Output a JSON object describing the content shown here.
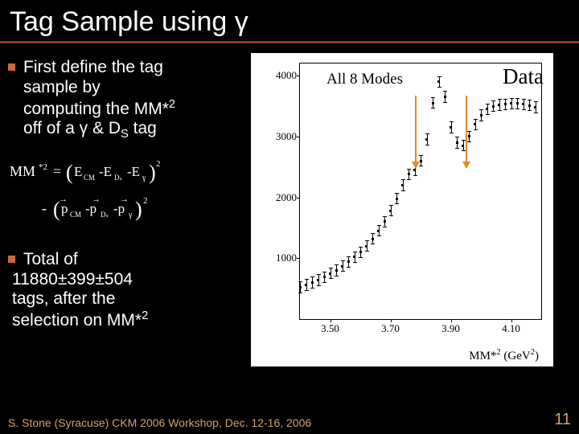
{
  "title": "Tag Sample using γ",
  "bullets": [
    "First  define the tag sample by computing the MM*² off of a γ & Dₛ tag",
    "Total of 11880±399±504 tags, after the selection on MM*²"
  ],
  "bullet1_lines": {
    "l1": "First  define the tag",
    "l2": "sample by",
    "l3_a": "computing the MM*",
    "l3_sup": "2",
    "l4_a": "off of a γ & D",
    "l4_sub": "S",
    "l4_b": " tag"
  },
  "bullet2_lines": {
    "l1": "Total of",
    "l2": "11880±399±504",
    "l3": "tags, after the",
    "l4_a": "selection on MM*",
    "l4_sup": "2"
  },
  "formula_text": "MM*² = (E_CM − E_Dₛ − E_γ)² − (p_CM − p_Dₛ − p_γ)²",
  "chart_annotations": {
    "all_modes": "All 8 Modes",
    "data": "Data"
  },
  "chart_data": {
    "type": "scatter",
    "title": "",
    "xlabel": "MM*² (GeV²)",
    "ylabel": "",
    "xlim": [
      3.4,
      4.2
    ],
    "ylim": [
      0,
      4200
    ],
    "xticks": [
      3.5,
      3.7,
      3.9,
      4.1
    ],
    "yticks": [
      1000,
      2000,
      3000,
      4000
    ],
    "points": [
      {
        "x": 3.4,
        "y": 520
      },
      {
        "x": 3.42,
        "y": 560
      },
      {
        "x": 3.44,
        "y": 600
      },
      {
        "x": 3.46,
        "y": 640
      },
      {
        "x": 3.48,
        "y": 690
      },
      {
        "x": 3.5,
        "y": 750
      },
      {
        "x": 3.52,
        "y": 800
      },
      {
        "x": 3.54,
        "y": 870
      },
      {
        "x": 3.56,
        "y": 940
      },
      {
        "x": 3.58,
        "y": 1020
      },
      {
        "x": 3.6,
        "y": 1100
      },
      {
        "x": 3.62,
        "y": 1200
      },
      {
        "x": 3.64,
        "y": 1320
      },
      {
        "x": 3.66,
        "y": 1450
      },
      {
        "x": 3.68,
        "y": 1600
      },
      {
        "x": 3.7,
        "y": 1780
      },
      {
        "x": 3.72,
        "y": 1980
      },
      {
        "x": 3.74,
        "y": 2200
      },
      {
        "x": 3.76,
        "y": 2380
      },
      {
        "x": 3.78,
        "y": 2450
      },
      {
        "x": 3.8,
        "y": 2600
      },
      {
        "x": 3.82,
        "y": 2950
      },
      {
        "x": 3.84,
        "y": 3550
      },
      {
        "x": 3.86,
        "y": 3900
      },
      {
        "x": 3.88,
        "y": 3650
      },
      {
        "x": 3.9,
        "y": 3150
      },
      {
        "x": 3.92,
        "y": 2900
      },
      {
        "x": 3.94,
        "y": 2850
      },
      {
        "x": 3.96,
        "y": 3000
      },
      {
        "x": 3.98,
        "y": 3200
      },
      {
        "x": 4.0,
        "y": 3350
      },
      {
        "x": 4.02,
        "y": 3450
      },
      {
        "x": 4.04,
        "y": 3500
      },
      {
        "x": 4.06,
        "y": 3520
      },
      {
        "x": 4.08,
        "y": 3530
      },
      {
        "x": 4.1,
        "y": 3540
      },
      {
        "x": 4.12,
        "y": 3540
      },
      {
        "x": 4.14,
        "y": 3530
      },
      {
        "x": 4.16,
        "y": 3510
      },
      {
        "x": 4.18,
        "y": 3480
      }
    ],
    "arrow_x": [
      3.78,
      3.95
    ],
    "error_y": 95
  },
  "xlabel_parts": {
    "a": "MM*",
    "sup1": "2",
    "b": " (GeV",
    "sup2": "2",
    "c": ")"
  },
  "footer": "S. Stone (Syracuse) CKM 2006 Workshop, Dec. 12-16, 2006",
  "page_number": "11"
}
